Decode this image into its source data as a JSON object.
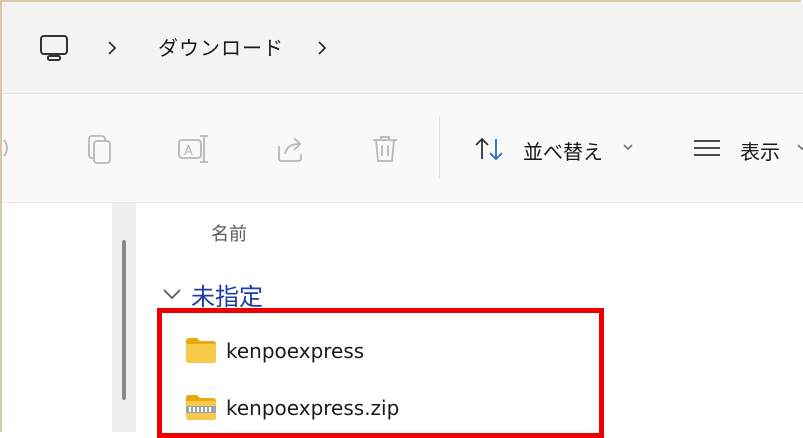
{
  "address_bar": {
    "pc_icon": "pc-monitor-icon",
    "separator_icon": "chevron-right-icon",
    "current_folder": "ダウンロード"
  },
  "toolbar": {
    "icons": [
      "copy-icon",
      "rename-icon",
      "share-icon",
      "delete-icon"
    ],
    "sort_label": "並べ替え",
    "view_label": "表示"
  },
  "list": {
    "column_name": "名前",
    "group_label": "未指定",
    "files": [
      {
        "name": "kenpoexpress",
        "icon": "folder-icon"
      },
      {
        "name": "kenpoexpress.zip",
        "icon": "zip-folder-icon"
      }
    ]
  },
  "colors": {
    "highlight": "#ee0000",
    "group_label": "#1f3fa3",
    "folder": "#f7c948"
  }
}
